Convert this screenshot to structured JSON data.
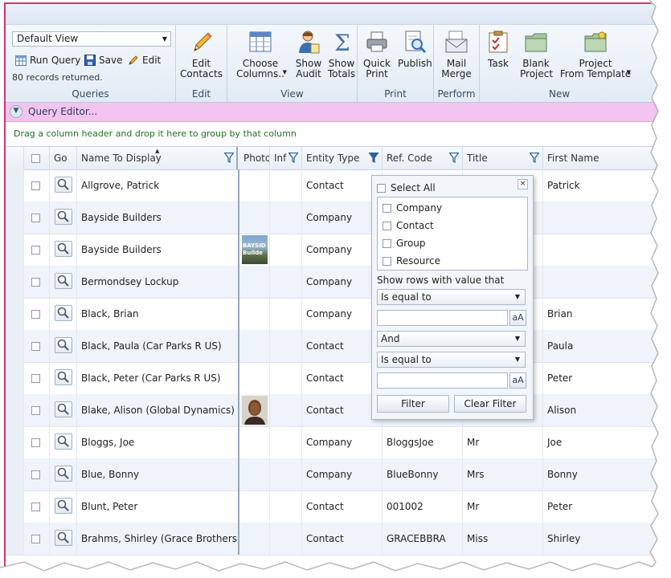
{
  "ribbon": {
    "view_select": "Default View",
    "run_query": "Run Query",
    "save": "Save",
    "edit": "Edit",
    "records": "80 records returned.",
    "groups": [
      {
        "label": "Queries"
      },
      {
        "label": "Edit"
      },
      {
        "label": "View"
      },
      {
        "label": "Print"
      },
      {
        "label": "Perform"
      },
      {
        "label": "New"
      }
    ],
    "edit_contacts": "Edit\nContacts",
    "choose_columns": "Choose\nColumns..",
    "show_audit": "Show\nAudit",
    "show_totals": "Show\nTotals",
    "quick_print": "Quick\nPrint",
    "publish": "Publish",
    "mail_merge": "Mail\nMerge",
    "task": "Task",
    "blank_project": "Blank\nProject",
    "project_from_template": "Project\nFrom Template"
  },
  "query_editor": "Query Editor...",
  "group_hint": "Drag a column header and drop it here to group by that column",
  "columns": {
    "go": "Go",
    "name": "Name To Display",
    "photo": "Photo",
    "info": "Inf",
    "entity": "Entity Type",
    "ref": "Ref. Code",
    "title": "Title",
    "first": "First Name"
  },
  "rows": [
    {
      "name": "Allgrove, Patrick",
      "entity": "Contact",
      "ref": "",
      "title": "",
      "first": "Patrick",
      "photo": ""
    },
    {
      "name": "Bayside Builders",
      "entity": "Company",
      "ref": "",
      "title": "",
      "first": "",
      "photo": ""
    },
    {
      "name": "Bayside Builders",
      "entity": "Company",
      "ref": "",
      "title": "",
      "first": "",
      "photo": "bayside-logo",
      "photo_text": "BAYSID\nBuilde"
    },
    {
      "name": "Bermondsey Lockup",
      "entity": "Company",
      "ref": "",
      "title": "",
      "first": "",
      "photo": ""
    },
    {
      "name": "Black, Brian",
      "entity": "Company",
      "ref": "",
      "title": "",
      "first": "Brian",
      "photo": ""
    },
    {
      "name": "Black, Paula (Car Parks R US)",
      "entity": "Contact",
      "ref": "",
      "title": "",
      "first": "Paula",
      "photo": ""
    },
    {
      "name": "Black, Peter (Car Parks R US)",
      "entity": "Contact",
      "ref": "",
      "title": "",
      "first": "Peter",
      "photo": ""
    },
    {
      "name": "Blake, Alison (Global Dynamics)",
      "entity": "Contact",
      "ref": "",
      "title": "",
      "first": "Alison",
      "photo": "person-photo"
    },
    {
      "name": "Bloggs, Joe",
      "entity": "Company",
      "ref": "BloggsJoe",
      "title": "Mr",
      "first": "Joe",
      "photo": ""
    },
    {
      "name": "Blue, Bonny",
      "entity": "Company",
      "ref": "BlueBonny",
      "title": "Mrs",
      "first": "Bonny",
      "photo": ""
    },
    {
      "name": "Blunt, Peter",
      "entity": "Contact",
      "ref": "001002",
      "title": "Mr",
      "first": "Peter",
      "photo": ""
    },
    {
      "name": "Brahms, Shirley (Grace Brothers)",
      "entity": "Contact",
      "ref": "GRACEBBRA",
      "title": "Miss",
      "first": "Shirley",
      "photo": ""
    }
  ],
  "filter_popup": {
    "select_all": "Select All",
    "options": [
      "Company",
      "Contact",
      "Group",
      "Resource"
    ],
    "show_rows_label": "Show rows with value that",
    "op1": "Is equal to",
    "logic": "And",
    "op2": "Is equal to",
    "aa": "aA",
    "filter_btn": "Filter",
    "clear_btn": "Clear Filter"
  },
  "colors": {
    "accent_border": "#d6336c",
    "query_editor_bg": "#f3c4f0",
    "alt_row": "#eef4fa"
  }
}
